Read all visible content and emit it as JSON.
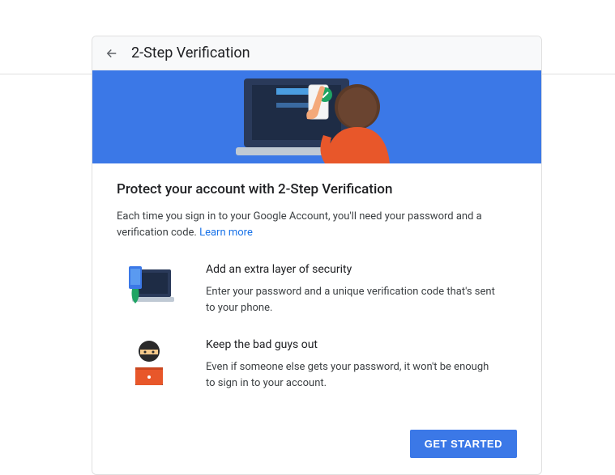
{
  "header": {
    "title": "2-Step Verification"
  },
  "main": {
    "title": "Protect your account with 2-Step Verification",
    "description": "Each time you sign in to your Google Account, you'll need your password and a verification code. ",
    "learn_more": "Learn more"
  },
  "features": [
    {
      "title": "Add an extra layer of security",
      "description": "Enter your password and a unique verification code that's sent to your phone."
    },
    {
      "title": "Keep the bad guys out",
      "description": "Even if someone else gets your password, it won't be enough to sign in to your account."
    }
  ],
  "footer": {
    "get_started": "GET STARTED"
  }
}
